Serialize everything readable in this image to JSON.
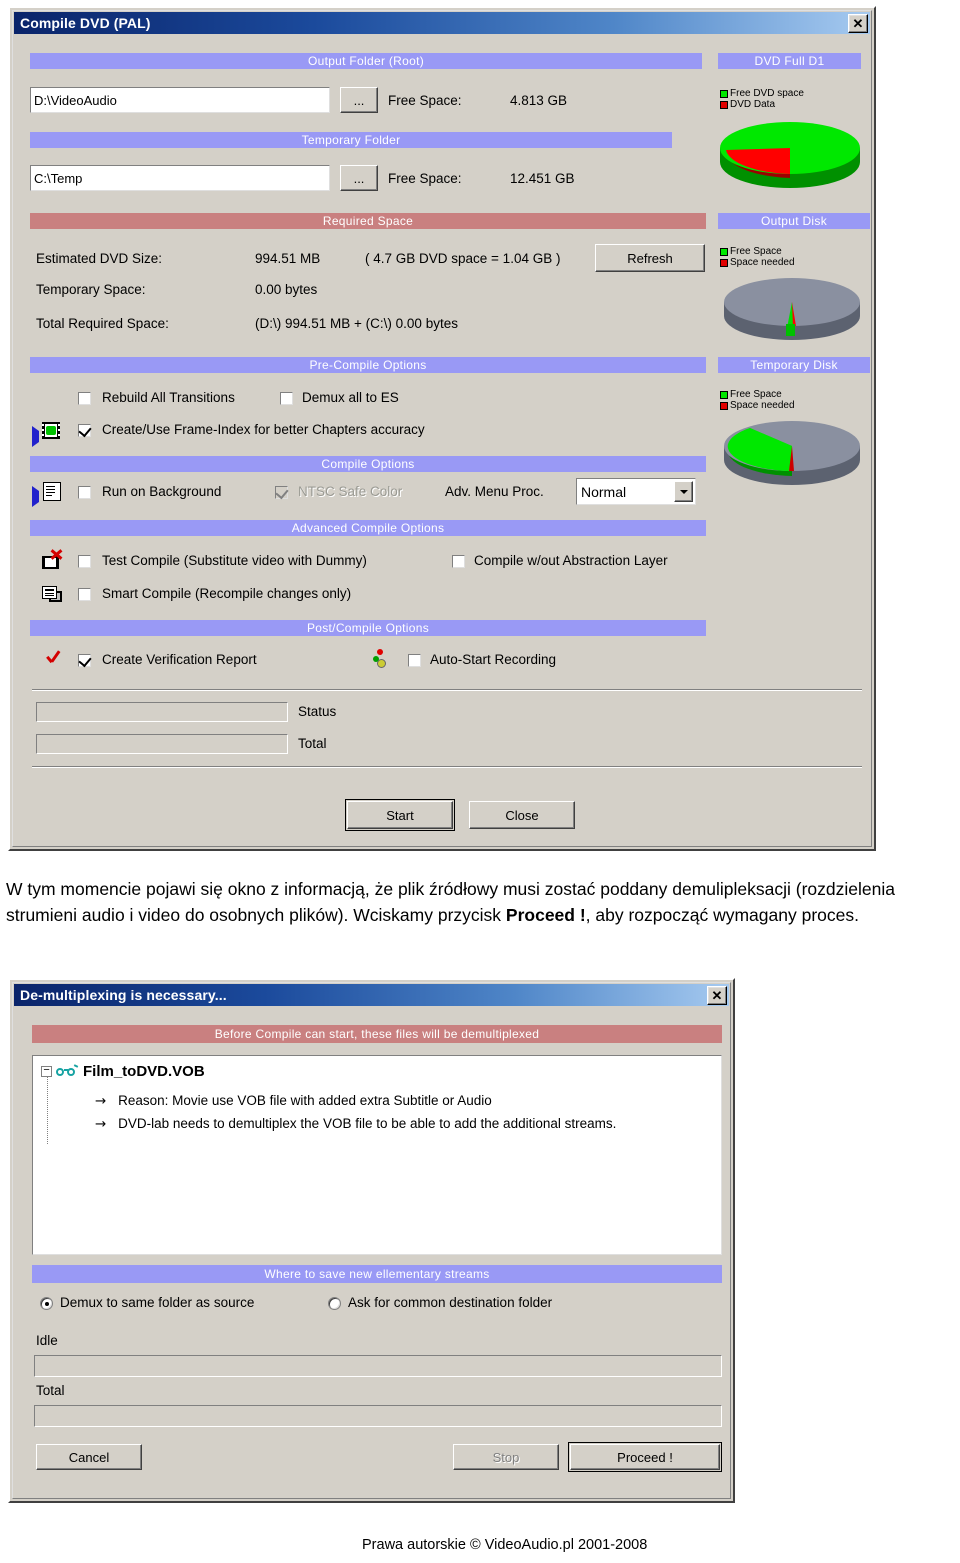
{
  "compile_dialog": {
    "title": "Compile DVD (PAL)",
    "close_label": "✕",
    "output_folder": {
      "bar": "Output Folder (Root)",
      "path": "D:\\VideoAudio",
      "browse_label": "...",
      "free_space_label": "Free Space:",
      "free_space_value": "4.813 GB"
    },
    "temporary_folder": {
      "bar": "Temporary Folder",
      "path": "C:\\Temp",
      "browse_label": "...",
      "free_space_label": "Free Space:",
      "free_space_value": "12.451 GB"
    },
    "required_space": {
      "bar": "Required Space",
      "estimated_label": "Estimated DVD Size:",
      "estimated_value": "994.51 MB",
      "estimated_note": "( 4.7 GB DVD space = 1.04 GB )",
      "temporary_label": "Temporary Space:",
      "temporary_value": "0.00 bytes",
      "total_label": "Total Required Space:",
      "total_value": "(D:\\) 994.51 MB + (C:\\) 0.00 bytes",
      "refresh_label": "Refresh"
    },
    "pre_compile": {
      "bar": "Pre-Compile Options",
      "rebuild_transitions": "Rebuild All Transitions",
      "demux_all_to_es": "Demux all to ES",
      "frame_index": "Create/Use Frame-Index for better Chapters accuracy"
    },
    "compile_options": {
      "bar": "Compile Options",
      "run_background": "Run on Background",
      "ntsc_safe_color": "NTSC Safe Color",
      "adv_menu_proc_label": "Adv. Menu Proc.",
      "adv_menu_proc_value": "Normal"
    },
    "advanced_compile": {
      "bar": "Advanced Compile Options",
      "test_compile": "Test Compile (Substitute video with Dummy)",
      "compile_wout_abstraction": "Compile w/out Abstraction Layer",
      "smart_compile": "Smart Compile (Recompile changes only)"
    },
    "post_compile": {
      "bar": "Post/Compile Options",
      "create_verification_report": "Create Verification Report",
      "auto_start_recording": "Auto-Start Recording"
    },
    "progress": {
      "status_label": "Status",
      "total_label": "Total"
    },
    "buttons": {
      "start": "Start",
      "close": "Close"
    },
    "panels": [
      {
        "bar": "DVD Full D1",
        "legend": [
          {
            "label": "Free DVD space",
            "color": "#00e800"
          },
          {
            "label": "DVD Data",
            "color": "#e00000"
          }
        ]
      },
      {
        "bar": "Output Disk",
        "legend": [
          {
            "label": "Free Space",
            "color": "#00e800"
          },
          {
            "label": "Space needed",
            "color": "#e00000"
          }
        ]
      },
      {
        "bar": "Temporary Disk",
        "legend": [
          {
            "label": "Free Space",
            "color": "#00e800"
          },
          {
            "label": "Space needed",
            "color": "#e00000"
          }
        ]
      }
    ],
    "chart_data": [
      {
        "type": "pie",
        "title": "DVD Full D1",
        "labels": [
          "Free DVD space",
          "DVD Data"
        ],
        "values": [
          79,
          21
        ],
        "colors": [
          "#00e800",
          "#e00000"
        ],
        "legend": "top-left",
        "note": "3D pie, free space dominant"
      },
      {
        "type": "pie",
        "title": "Output Disk",
        "labels": [
          "Free Space",
          "Space needed"
        ],
        "values": [
          3,
          1
        ],
        "colors": [
          "#00e800",
          "#e00000"
        ],
        "legend": "top-left",
        "note": "3D pie mostly grey (used/other); thin green and red slivers at bottom"
      },
      {
        "type": "pie",
        "title": "Temporary Disk",
        "labels": [
          "Free Space",
          "Space needed"
        ],
        "values": [
          55,
          1
        ],
        "colors": [
          "#00e800",
          "#e00000"
        ],
        "legend": "top-left",
        "note": "3D pie, green left half, grey remainder, thin red sliver"
      }
    ]
  },
  "paragraph": {
    "line1": "W tym momencie pojawi się okno z informacją, że plik źródłowy musi zostać poddany",
    "line2": "demulipleksacji (rozdzielenia strumieni audio i video do osobnych plików). Wciskamy przycisk",
    "bold": "Proceed !",
    "line3_rest": ", aby rozpocząć wymagany proces."
  },
  "demux_dialog": {
    "title": "De-multiplexing is necessary...",
    "close_label": "✕",
    "header_bar": "Before Compile can start, these files will be demultiplexed",
    "tree": {
      "expander": "−",
      "icon": "glasses-icon",
      "root": "Film_toDVD.VOB",
      "children": [
        "Reason: Movie use VOB file with added extra Subtitle or Audio",
        "DVD-lab needs to demultiplex the VOB file to be able to add the additional streams."
      ]
    },
    "where_bar": "Where to save new ellementary streams",
    "radio_same_folder": "Demux to same folder as source",
    "radio_ask_folder": "Ask for common destination folder",
    "idle_label": "Idle",
    "total_label": "Total",
    "buttons": {
      "cancel": "Cancel",
      "stop": "Stop",
      "proceed": "Proceed !"
    }
  },
  "footer": {
    "text": "Prawa autorskie © VideoAudio.pl 2001-2008"
  }
}
